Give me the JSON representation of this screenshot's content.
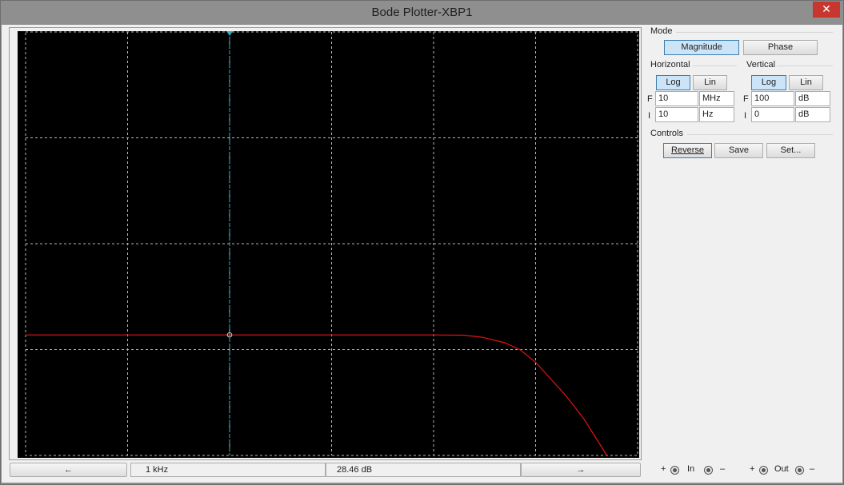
{
  "window": {
    "title": "Bode Plotter-XBP1",
    "close_glyph": "✕"
  },
  "mode": {
    "label": "Mode",
    "buttons": [
      {
        "label": "Magnitude",
        "active": true
      },
      {
        "label": "Phase",
        "active": false
      }
    ]
  },
  "horizontal": {
    "label": "Horizontal",
    "log_label": "Log",
    "lin_label": "Lin",
    "scale": "Log",
    "final_label": "F",
    "final_value": "10",
    "final_unit": "MHz",
    "initial_label": "I",
    "initial_value": "10",
    "initial_unit": "Hz"
  },
  "vertical": {
    "label": "Vertical",
    "log_label": "Log",
    "lin_label": "Lin",
    "scale": "Log",
    "final_label": "F",
    "final_value": "100",
    "final_unit": "dB",
    "initial_label": "I",
    "initial_value": "0",
    "initial_unit": "dB"
  },
  "controls": {
    "label": "Controls",
    "reverse_label": "Reverse",
    "save_label": "Save",
    "set_label": "Set..."
  },
  "readout": {
    "left_arrow": "←",
    "right_arrow": "→",
    "frequency": "1 kHz",
    "magnitude": "28.46 dB"
  },
  "terminals": {
    "plus": "+",
    "minus": "–",
    "in_label": "In",
    "out_label": "Out"
  },
  "colors": {
    "trace": "#e0140f",
    "cursor": "#2ab3c3",
    "grid": "#b8b8b8",
    "screen": "#000000",
    "active_button": "#cce4f7"
  },
  "chart_data": {
    "type": "line",
    "title": "",
    "xlabel": "",
    "ylabel": "",
    "x_scale": "log",
    "xlim": [
      10,
      10000000
    ],
    "ylim": [
      0,
      100
    ],
    "grid": true,
    "cursor_x": 1000,
    "series": [
      {
        "x": [
          10,
          100,
          1000,
          10000,
          50000,
          100000,
          200000,
          300000,
          500000,
          700000,
          1000000,
          2000000,
          3000000,
          5000000
        ],
        "y": [
          28.46,
          28.46,
          28.46,
          28.46,
          28.46,
          28.46,
          28.4,
          27.9,
          26.6,
          25,
          22,
          14,
          8.5,
          0
        ]
      }
    ]
  }
}
